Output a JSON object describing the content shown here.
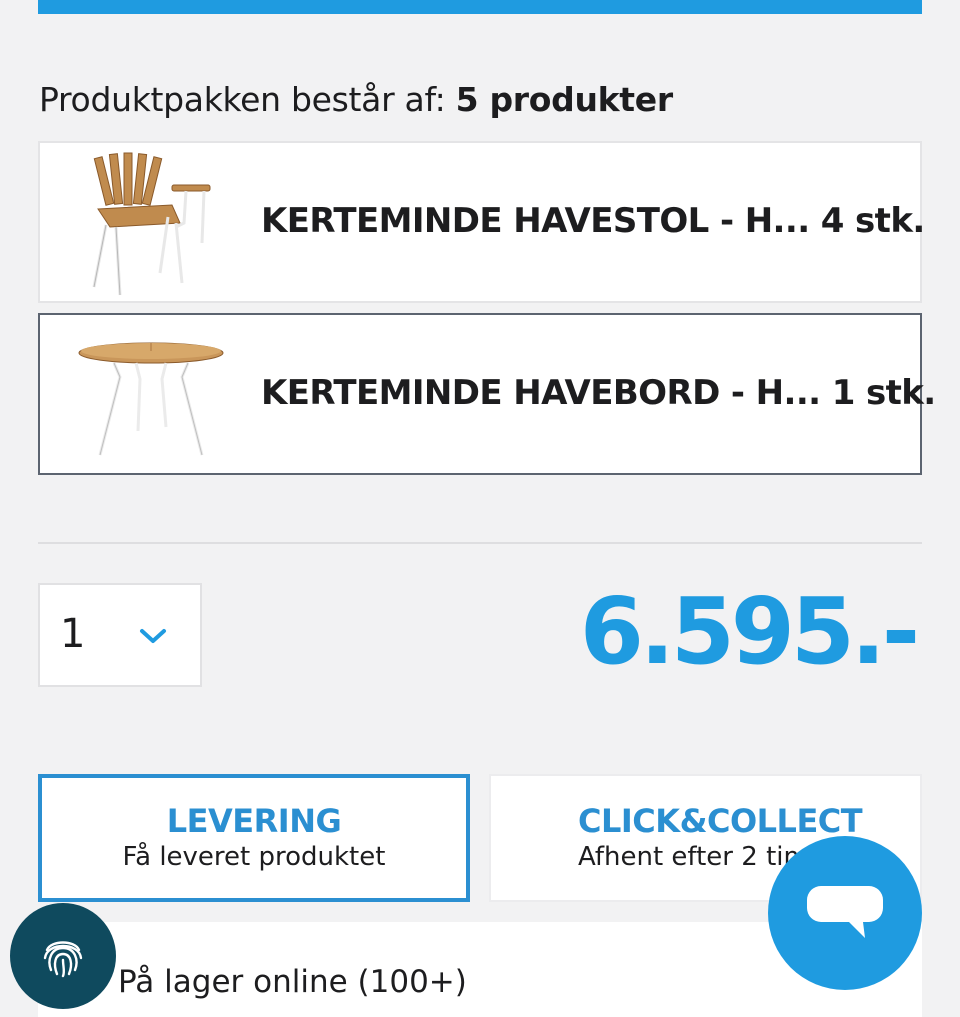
{
  "colors": {
    "accent": "#1f9be0",
    "accent_dark": "#2b8fd1",
    "fingerprint_bg": "#0f4a5e"
  },
  "package": {
    "heading_prefix": "Produktpakken består af: ",
    "heading_count": "5 produkter",
    "items": [
      {
        "name": "KERTEMINDE HAVESTOL - H... 4 stk.",
        "icon": "garden-chair-image"
      },
      {
        "name": "KERTEMINDE HAVEBORD - H... 1 stk.",
        "icon": "garden-table-image"
      }
    ]
  },
  "quantity": {
    "value": "1"
  },
  "price": {
    "text": "6.595.-"
  },
  "delivery": {
    "options": [
      {
        "title": "LEVERING",
        "subtitle": "Få leveret produktet"
      },
      {
        "title": "CLICK&COLLECT",
        "subtitle": "Afhent efter 2 timer"
      }
    ]
  },
  "stock": {
    "text": "På lager online (100+)"
  }
}
